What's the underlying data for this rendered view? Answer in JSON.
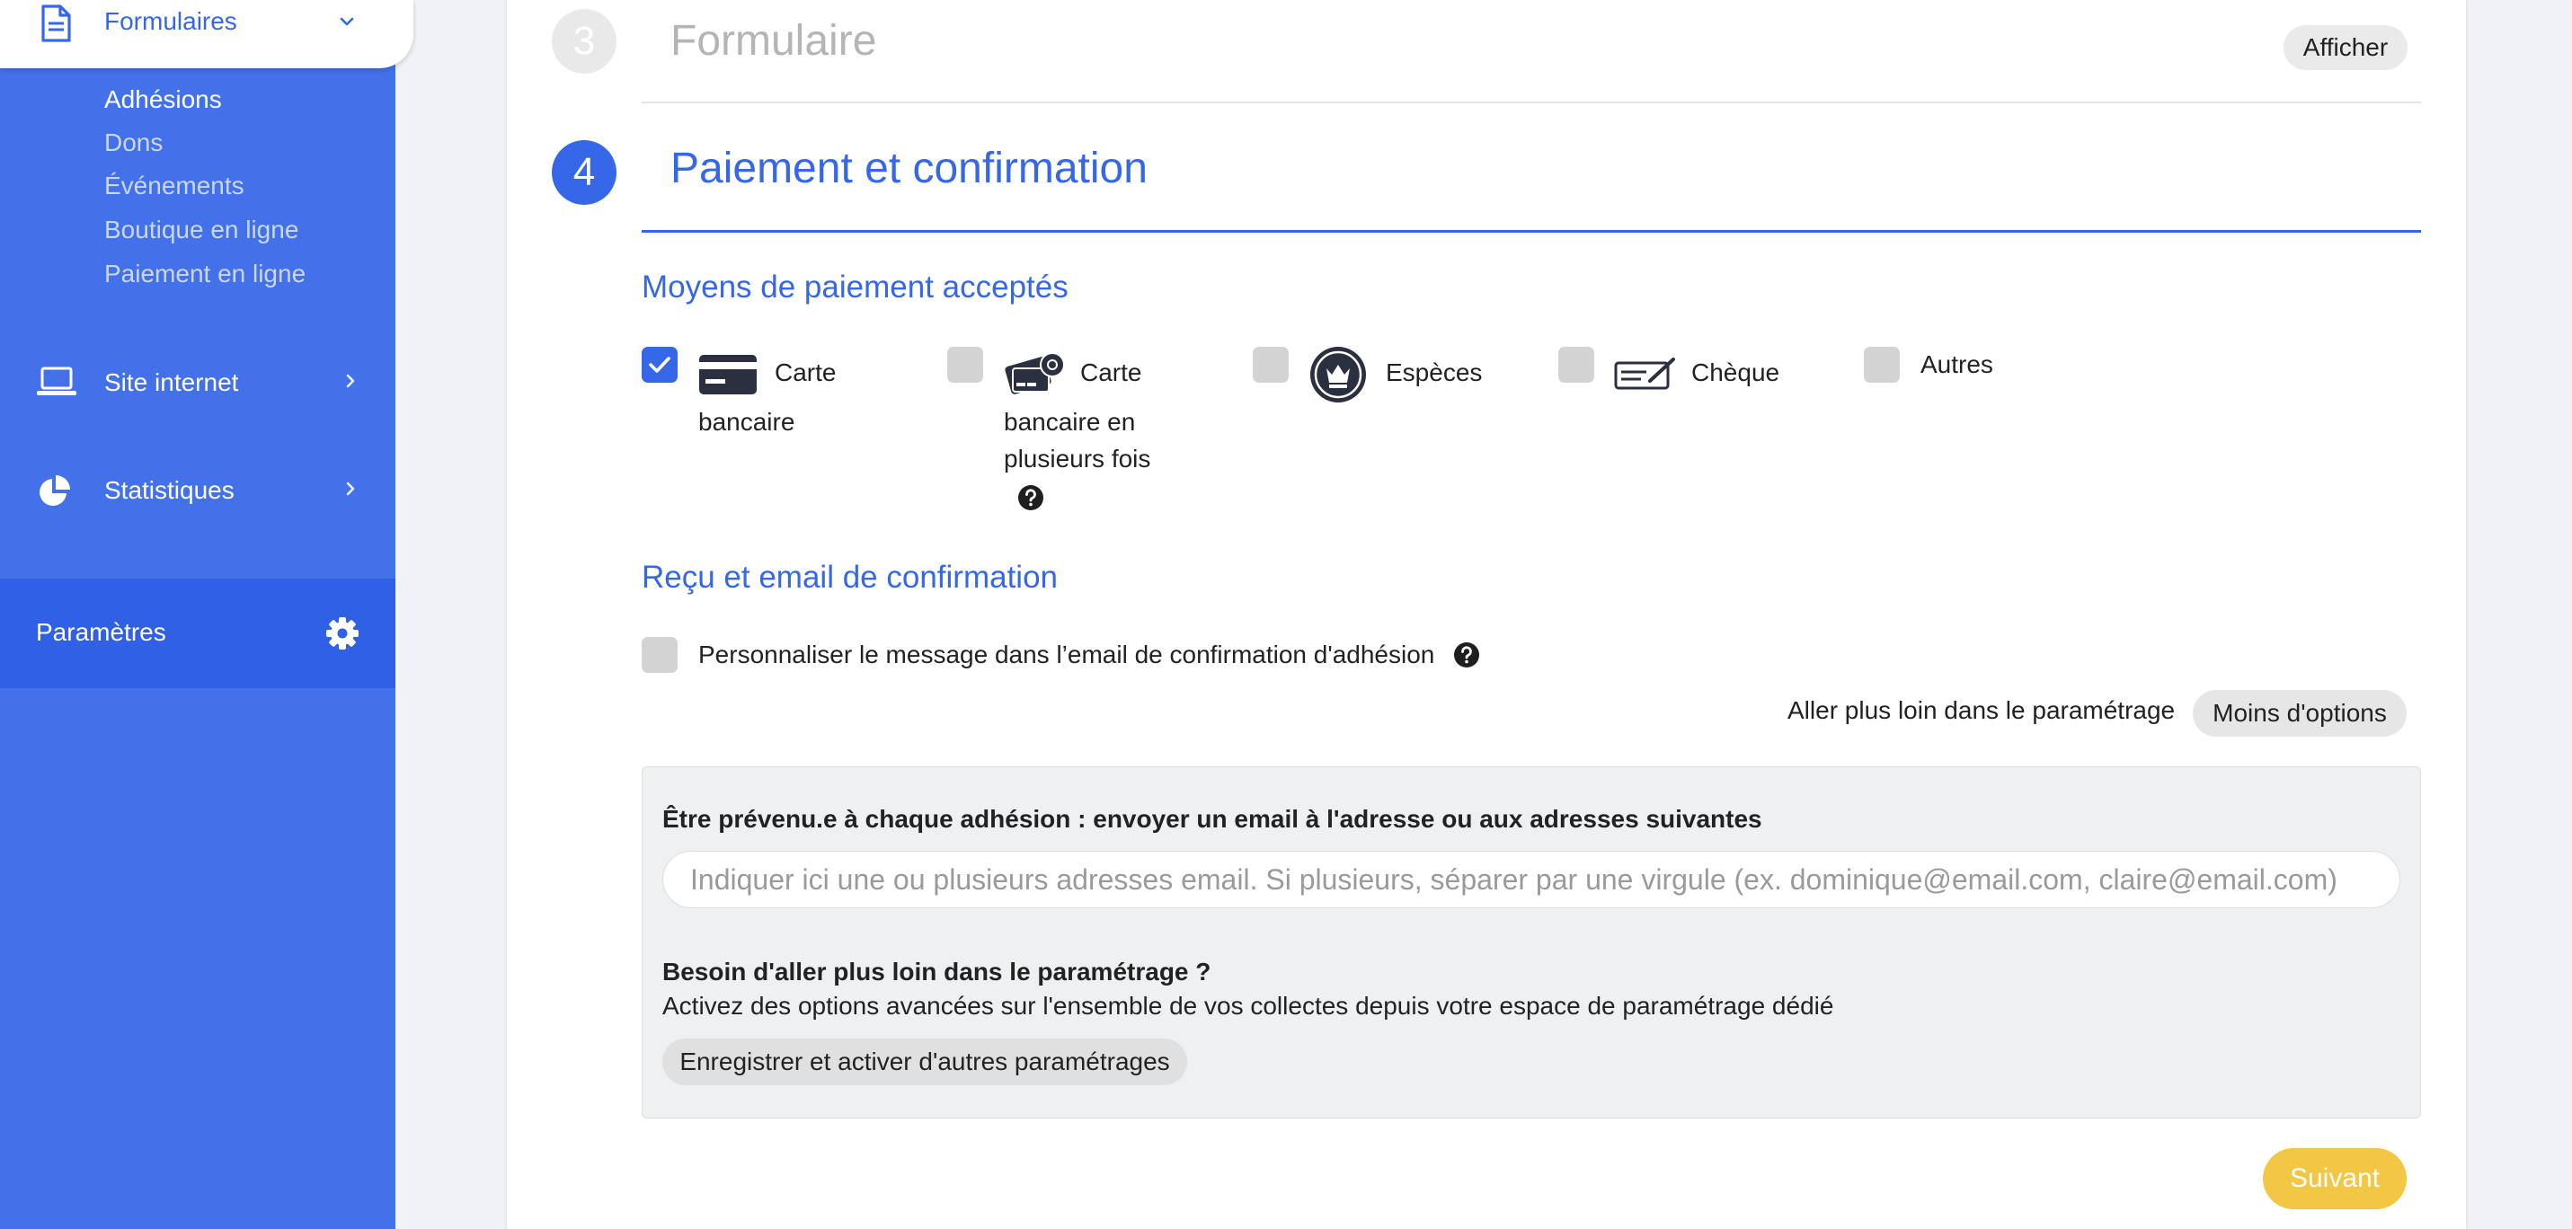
{
  "sidebar": {
    "formulaires_label": "Formulaires",
    "sub_items": [
      {
        "label": "Adhésions"
      },
      {
        "label": "Dons"
      },
      {
        "label": "Événements"
      },
      {
        "label": "Boutique en ligne"
      },
      {
        "label": "Paiement en ligne"
      }
    ],
    "site_label": "Site internet",
    "stats_label": "Statistiques",
    "settings_label": "Paramètres"
  },
  "steps": {
    "step3": {
      "number": "3",
      "title": "Formulaire",
      "show_button": "Afficher"
    },
    "step4": {
      "number": "4",
      "title": "Paiement et confirmation"
    }
  },
  "payment": {
    "section_title": "Moyens de paiement acceptés",
    "methods": [
      {
        "line1": "Carte",
        "line2": "bancaire",
        "checked": true,
        "icon": "credit-card-icon"
      },
      {
        "line1": "Carte",
        "line2": "bancaire en",
        "line3": "plusieurs fois",
        "checked": false,
        "icon": "card-installments-icon",
        "help": true
      },
      {
        "line1": "Espèces",
        "checked": false,
        "icon": "coin-icon"
      },
      {
        "line1": "Chèque",
        "checked": false,
        "icon": "cheque-icon"
      },
      {
        "line1": "Autres",
        "checked": false
      }
    ]
  },
  "confirmation": {
    "section_title": "Reçu et email de confirmation",
    "customize_label": "Personnaliser le message dans l’email de confirmation d'adhésion",
    "customize_checked": false,
    "advanced_label": "Aller plus loin dans le paramétrage",
    "less_options_button": "Moins d'options"
  },
  "notify_box": {
    "title": "Être prévenu.e à chaque adhésion : envoyer un email à l'adresse ou aux adresses suivantes",
    "email_placeholder": "Indiquer ici une ou plusieurs adresses email. Si plusieurs, séparer par une virgule (ex. dominique@email.com, claire@email.com)",
    "email_value": "",
    "question": "Besoin d'aller plus loin dans le paramétrage ?",
    "description": "Activez des options avancées sur l'ensemble de vos collectes depuis votre espace de paramétrage dédié",
    "save_button": "Enregistrer et activer d'autres paramétrages"
  },
  "next_button": "Suivant",
  "colors": {
    "primary": "#3567e8",
    "sidebar": "#4271ea",
    "sidebar_active": "#2f60e6",
    "next_button": "#f2c744"
  }
}
